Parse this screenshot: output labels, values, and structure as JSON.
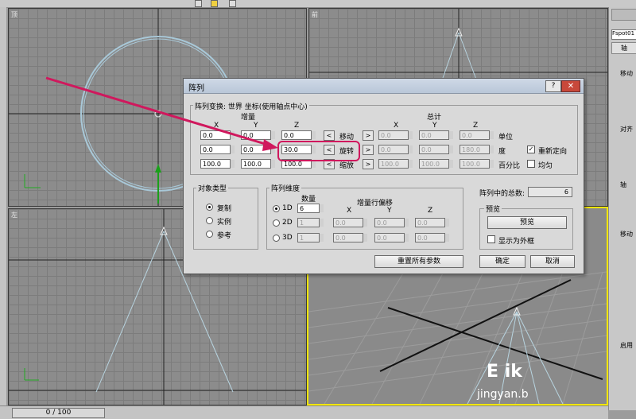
{
  "viewports": {
    "top_label": "顶",
    "front_label": "前",
    "left_label": "左",
    "persp_label": ""
  },
  "status": {
    "frame": "0 / 100"
  },
  "right_panel": {
    "name_field": "Fspot01",
    "tab": "轴",
    "labels": [
      "移动",
      "对齐",
      "轴",
      "移动",
      "启用"
    ]
  },
  "dialog": {
    "title": "阵列",
    "help_label": "?",
    "close_label": "✕",
    "transform_group": "阵列变换: 世界 坐标(使用轴点中心)",
    "increment_label": "增量",
    "totals_label": "总计",
    "axis_x": "X",
    "axis_y": "Y",
    "axis_z": "Z",
    "rows": [
      {
        "name": "移动",
        "inc": [
          "0.0",
          "0.0",
          "0.0"
        ],
        "tot": [
          "0.0",
          "0.0",
          "0.0"
        ],
        "unit": "单位",
        "option": ""
      },
      {
        "name": "旋转",
        "inc": [
          "0.0",
          "0.0",
          "30.0"
        ],
        "tot": [
          "0.0",
          "0.0",
          "180.0"
        ],
        "unit": "度",
        "option": "重新定向"
      },
      {
        "name": "缩放",
        "inc": [
          "100.0",
          "100.0",
          "100.0"
        ],
        "tot": [
          "100.0",
          "100.0",
          "100.0"
        ],
        "unit": "百分比",
        "option": "均匀"
      }
    ],
    "left_arrow": "<",
    "right_arrow": ">",
    "object_type": {
      "title": "对象类型",
      "options": [
        "复制",
        "实例",
        "参考"
      ],
      "selected": "复制"
    },
    "dimensions": {
      "title": "阵列维度",
      "count_label": "数量",
      "offset_label": "增量行偏移",
      "rows": [
        {
          "dim": "1D",
          "count": "6",
          "x": "",
          "y": "",
          "z": ""
        },
        {
          "dim": "2D",
          "count": "1",
          "x": "0.0",
          "y": "0.0",
          "z": "0.0"
        },
        {
          "dim": "3D",
          "count": "1",
          "x": "0.0",
          "y": "0.0",
          "z": "0.0"
        }
      ]
    },
    "total_in_array_label": "阵列中的总数:",
    "total_in_array": "6",
    "preview": {
      "title": "预览",
      "button": "预览",
      "show_as_box": "显示为外框"
    },
    "reset_button": "重置所有参数",
    "ok_button": "确定",
    "cancel_button": "取消"
  },
  "watermark": {
    "line1": "E  ik",
    "line2": "jingyan.b"
  },
  "colors": {
    "highlight": "#d0185d",
    "active_viewport": "#f2e60a",
    "dialog_bg": "#d9d9d9"
  }
}
